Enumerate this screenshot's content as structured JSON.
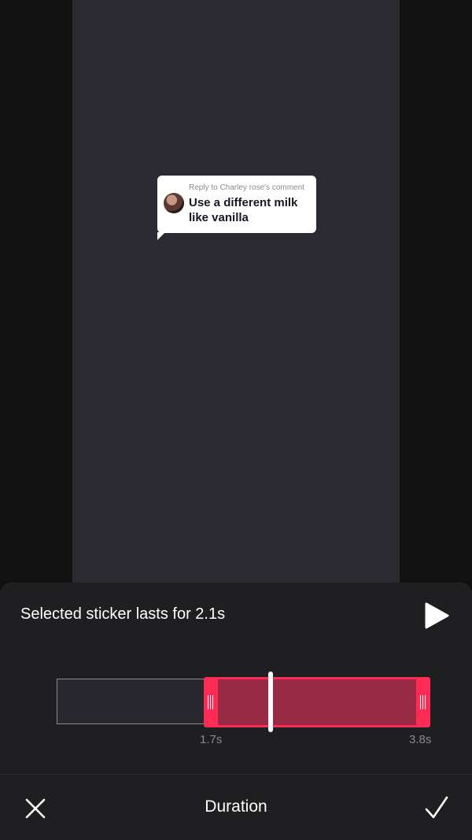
{
  "sticker": {
    "reply_to": "Reply to Charley rose's comment",
    "comment": "Use a different milk like vanilla"
  },
  "duration_panel": {
    "title": "Selected sticker lasts for 2.1s",
    "start_label": "1.7s",
    "end_label": "3.8s",
    "bottom_title": "Duration"
  },
  "icons": {
    "play": "play-icon",
    "close": "close-icon",
    "confirm": "checkmark-icon",
    "handle": "drag-grip-icon"
  },
  "colors": {
    "accent": "#fe2c55",
    "selection_fill": "#962b43",
    "panel_bg": "#1f1f21",
    "video_bg": "#2b2a31"
  }
}
